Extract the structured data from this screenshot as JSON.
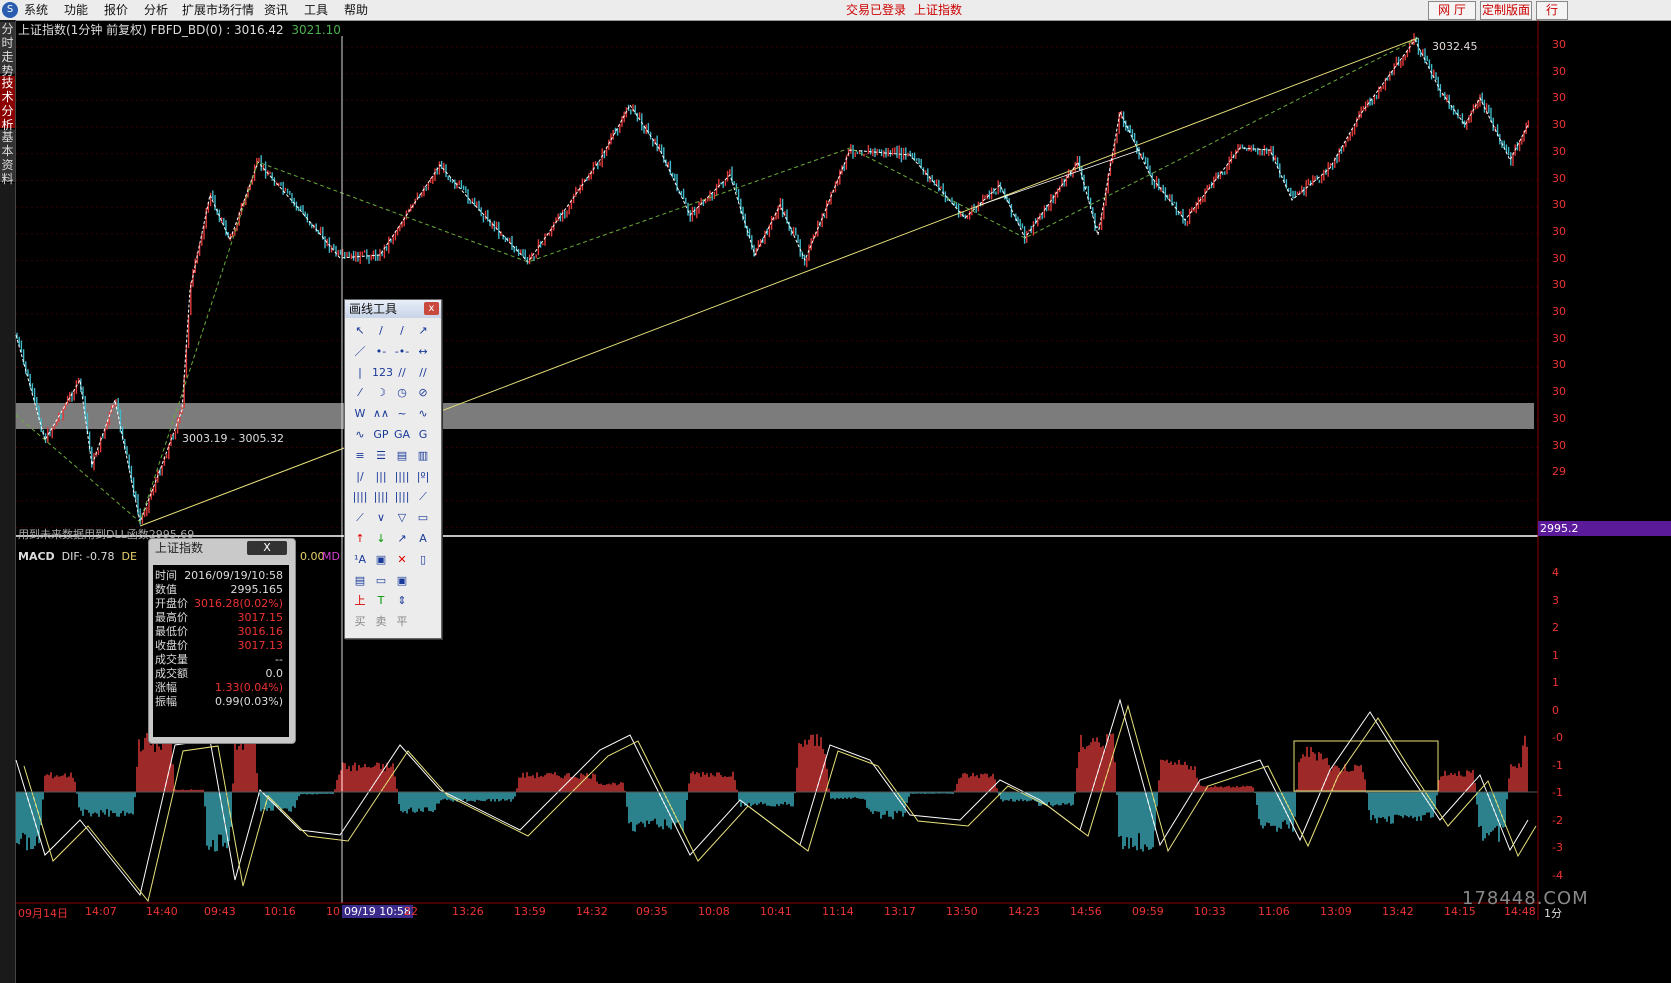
{
  "menubar": {
    "items": [
      "系统",
      "功能",
      "报价",
      "分析",
      "扩展市场行情",
      "资讯",
      "工具",
      "帮助"
    ],
    "status_login": "交易已登录",
    "status_index": "上证指数",
    "btn_hall": "网 厅",
    "btn_custom": "定制版面",
    "btn_row": "行"
  },
  "sidetabs": [
    "分时走势",
    "技术分析",
    "基本资料"
  ],
  "chart_header": {
    "title": "上证指数(1分钟 前复权) FBFD_BD(0) : 3016.42",
    "value2": "3021.10"
  },
  "annotations": {
    "high": "3032.45",
    "zone": "3003.19 - 3005.32",
    "low_note": "用到未来数据用到DLL函数2995.69",
    "current_price_tag": "2995.2"
  },
  "right_axis": {
    "price_ticks": [
      "30",
      "30",
      "30",
      "30",
      "30",
      "30",
      "30",
      "30",
      "30",
      "30",
      "30",
      "30",
      "30",
      "30",
      "30",
      "30",
      "29"
    ],
    "macd_ticks": [
      "4",
      "3",
      "2",
      "1",
      "1",
      "0",
      "-0",
      "-1",
      "-1",
      "-2",
      "-3",
      "-4"
    ]
  },
  "macd_header": {
    "name": "MACD",
    "dif": "DIF: -0.78",
    "dea": "DE",
    "val": "0.00",
    "macd": "MD"
  },
  "time_axis": [
    "09月14日",
    "14:07",
    "14:40",
    "09:43",
    "10:16",
    "10",
    "09/19 10:58",
    "22",
    "13:26",
    "13:59",
    "14:32",
    "09:35",
    "10:08",
    "10:41",
    "11:14",
    "13:17",
    "13:50",
    "14:23",
    "14:56",
    "09:59",
    "10:33",
    "11:06",
    "13:09",
    "13:42",
    "14:15",
    "14:48"
  ],
  "time_unit": "1分",
  "draw_tool": {
    "title": "画线工具",
    "close": "x",
    "trade_buttons": [
      "买",
      "卖",
      "平"
    ],
    "text_tool": "A",
    "up_label": "上",
    "down_label": "下"
  },
  "info_popup": {
    "title": "上证指数",
    "close": "X",
    "rows": [
      {
        "k": "时间",
        "v": "2016/09/19/10:58",
        "red": false
      },
      {
        "k": "数值",
        "v": "2995.165",
        "red": false
      },
      {
        "k": "开盘价",
        "v": "3016.28(0.02%)",
        "red": true
      },
      {
        "k": "最高价",
        "v": "3017.15",
        "red": true
      },
      {
        "k": "最低价",
        "v": "3016.16",
        "red": true
      },
      {
        "k": "收盘价",
        "v": "3017.13",
        "red": true
      },
      {
        "k": "成交量",
        "v": "--",
        "red": false
      },
      {
        "k": "成交额",
        "v": "0.0",
        "red": false
      },
      {
        "k": "涨幅",
        "v": "1.33(0.04%)",
        "red": true
      },
      {
        "k": "振幅",
        "v": "0.99(0.03%)",
        "red": false
      }
    ]
  },
  "watermark": "178448.COM",
  "colors": {
    "up": "#e33b3b",
    "down": "#3fb9c9",
    "white_line": "#ffffff",
    "yellow": "#e8e27a",
    "green_dash": "#6aaa3a",
    "purple_tag": "#5a1a9a"
  },
  "icons": [
    "cursor-icon",
    "line-icon",
    "ray-icon",
    "arrow-line-icon",
    "segment-icon",
    "h-line-icon",
    "v-line-icon",
    "channel-icon",
    "arc-icon",
    "circle-icon",
    "ellipse-icon",
    "wave-icon",
    "gann-fan-icon",
    "fib-icon",
    "cycle-icon",
    "box-icon",
    "up-arrow-icon",
    "down-arrow-icon",
    "delete-icon",
    "text-icon"
  ]
}
